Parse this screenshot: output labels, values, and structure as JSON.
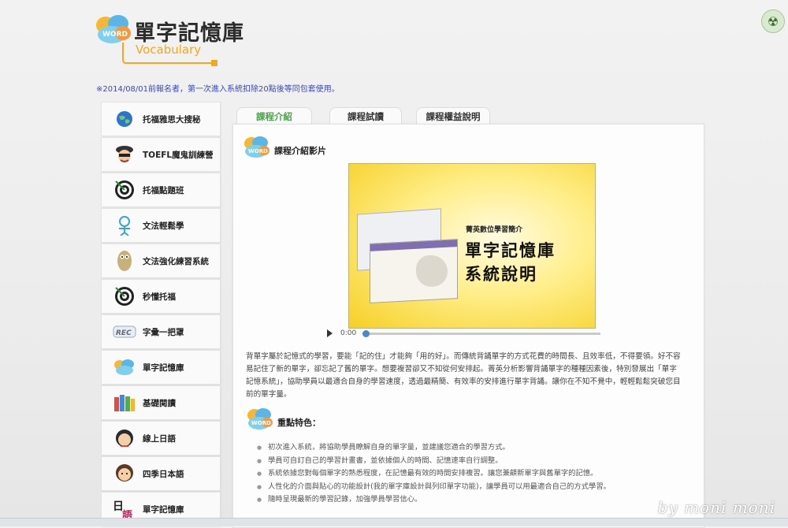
{
  "header": {
    "title": "單字記憶庫",
    "subtitle": "Vocabulary",
    "logo_badge": "WORD",
    "corner_icon": "radiation-icon"
  },
  "notice": "※2014/08/01前報名者，第一次進入系統扣除20點後等同包套使用。",
  "sidebar": {
    "items": [
      {
        "label": "托福雅思大搜秘",
        "icon": "globe-icon"
      },
      {
        "label": "TOEFL魔鬼訓練營",
        "icon": "mascot-icon"
      },
      {
        "label": "托福點題班",
        "icon": "target-icon"
      },
      {
        "label": "文法輕鬆學",
        "icon": "figure-icon"
      },
      {
        "label": "文法強化練習系統",
        "icon": "character-icon"
      },
      {
        "label": "秒懂托福",
        "icon": "target-icon"
      },
      {
        "label": "字彙一把罩",
        "icon": "rec-icon"
      },
      {
        "label": "單字記憶庫",
        "icon": "brain-icon"
      },
      {
        "label": "基礎閱讀",
        "icon": "books-icon"
      },
      {
        "label": "線上日語",
        "icon": "person-icon"
      },
      {
        "label": "四季日本語",
        "icon": "person-icon"
      },
      {
        "label": "單字記憶庫",
        "icon": "japanese-icon"
      }
    ]
  },
  "tabs": [
    {
      "label": "課程介紹",
      "active": true
    },
    {
      "label": "課程試讀",
      "active": false
    },
    {
      "label": "課程權益說明",
      "active": false
    }
  ],
  "content": {
    "video_section_title": "課程介紹影片",
    "video": {
      "kicker": "菁英數位學習簡介",
      "line1": "單字記憶庫",
      "line2": "系統說明",
      "time": "0:00"
    },
    "intro_text": "背單字屬於記憶式的學習，要能「記的住」才能夠「用的好」。而傳統背誦單字的方式花費的時間長、且效率低，不得要領。好不容易記住了新的單字，卻忘記了舊的單字。想要複習卻又不知從何安排起。菁英分析影響背誦單字的種種因素後，特別發展出「單字記憶系統」，協助學員以最適合自身的學習速度，透過最精簡、有效率的安排進行單字背誦。讓你在不知不覺中，輕輕鬆鬆突破您目前的單字量。",
    "features_title": "重點特色：",
    "features": [
      "初次進入系統，將協助學員瞭解自身的單字量，並建議您適合的學習方式。",
      "學員可自訂自己的學習計畫書，並依據個人的時間、記憶速率自行調整。",
      "系統依據您對每個單字的熟悉程度，在記憶最有效的時間安排複習。讓您兼顧新單字與舊單字的記憶。",
      "人性化的介面與貼心的功能設計(我的單字庫設計與列印單字功能)，讓學員可以用最適合自己的方式學習。",
      "隨時呈現最新的學習記錄，加強學員學習信心。"
    ]
  },
  "watermark": "by moni moni"
}
